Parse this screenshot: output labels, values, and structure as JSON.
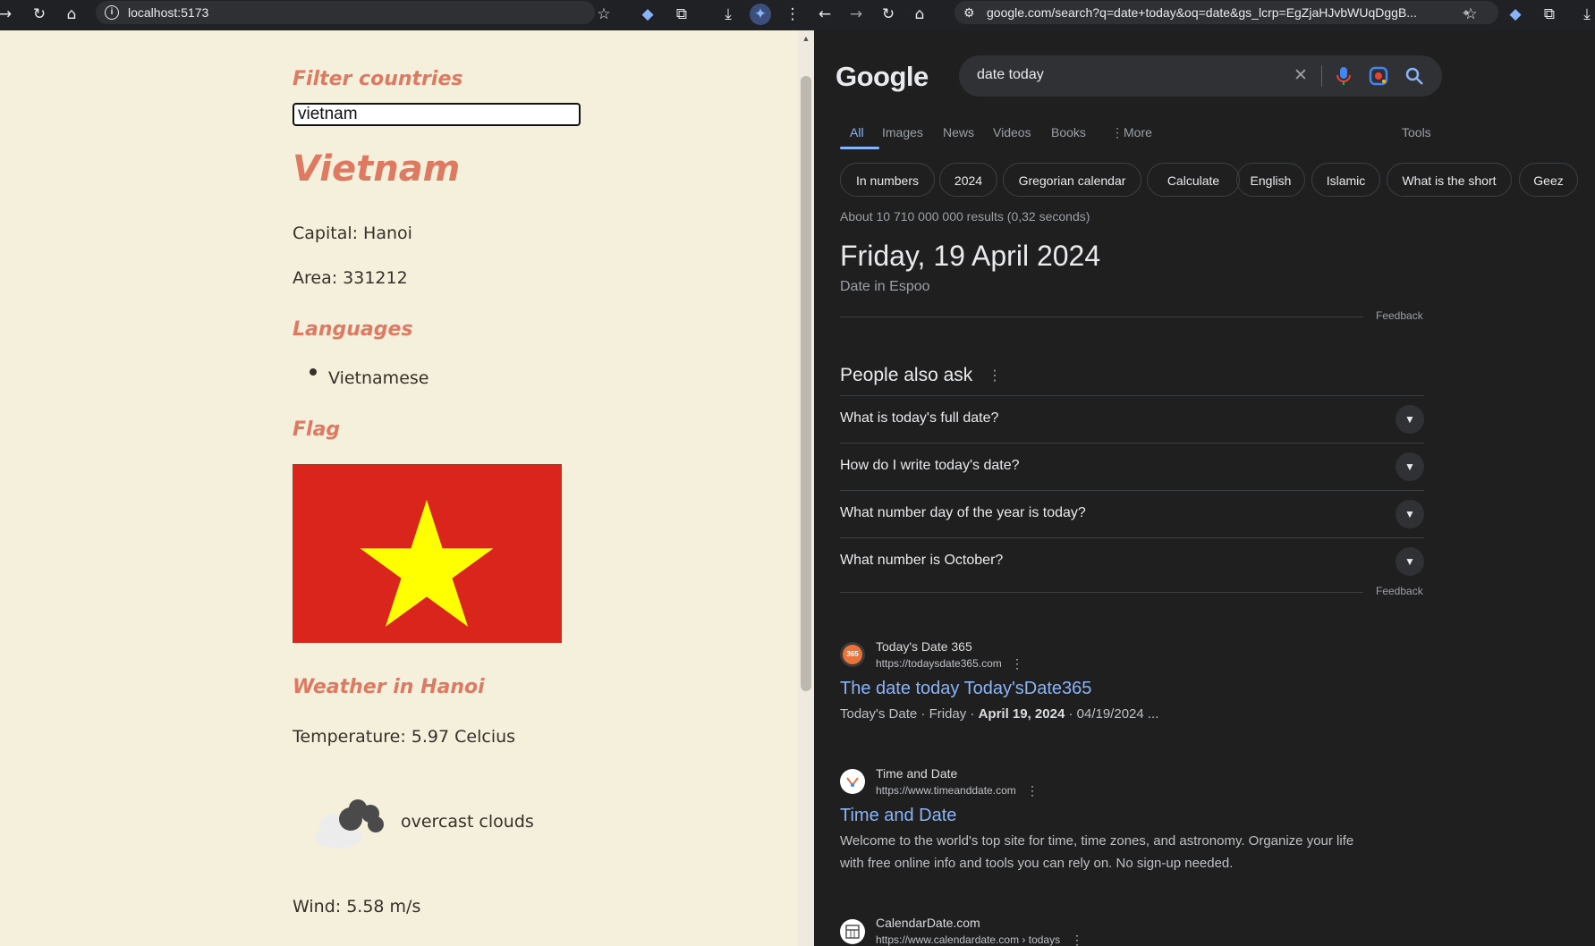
{
  "left_browser": {
    "url": "localhost:5173",
    "filter_label": "Filter countries",
    "filter_value": "vietnam",
    "country_name": "Vietnam",
    "capital": "Capital: Hanoi",
    "area": "Area: 331212",
    "languages_heading": "Languages",
    "languages": [
      "Vietnamese"
    ],
    "flag_heading": "Flag",
    "weather_heading": "Weather in Hanoi",
    "temperature": "Temperature: 5.97 Celcius",
    "weather_desc": "overcast clouds",
    "wind": "Wind: 5.58 m/s"
  },
  "right_browser": {
    "url": "google.com/search?q=date+today&oq=date&gs_lcrp=EgZjaHJvbWUqDggB...",
    "logo": "Google",
    "query": "date today",
    "tabs": [
      "All",
      "Images",
      "News",
      "Videos",
      "Books",
      "More",
      "Tools"
    ],
    "active_tab": "All",
    "chips": [
      "In numbers",
      "2024",
      "Gregorian calendar",
      "Calculate",
      "English",
      "Islamic",
      "What is the short",
      "Geez"
    ],
    "result_stats": "About 10 710 000 000 results (0,32 seconds)",
    "answer_date": "Friday, 19 April 2024",
    "answer_sub": "Date in Espoo",
    "feedback": "Feedback",
    "paa_heading": "People also ask",
    "paa": [
      "What is today's full date?",
      "How do I write today's date?",
      "What number day of the year is today?",
      "What number is October?"
    ],
    "results": [
      {
        "site": "Today's Date 365",
        "url": "https://todaysdate365.com",
        "title": "The date today Today'sDate365",
        "snippet": "Today's Date · Friday · ",
        "snippet_bold": "April 19, 2024",
        "snippet_tail": " · 04/19/2024 ...",
        "fav_label": "365"
      },
      {
        "site": "Time and Date",
        "url": "https://www.timeanddate.com",
        "title": "Time and Date",
        "snippet": "Welcome to the world's top site for time, time zones, and astronomy. Organize your life with free online info and tools you can rely on. No sign-up needed."
      },
      {
        "site": "CalendarDate.com",
        "url": "https://www.calendardate.com › todays"
      }
    ]
  }
}
